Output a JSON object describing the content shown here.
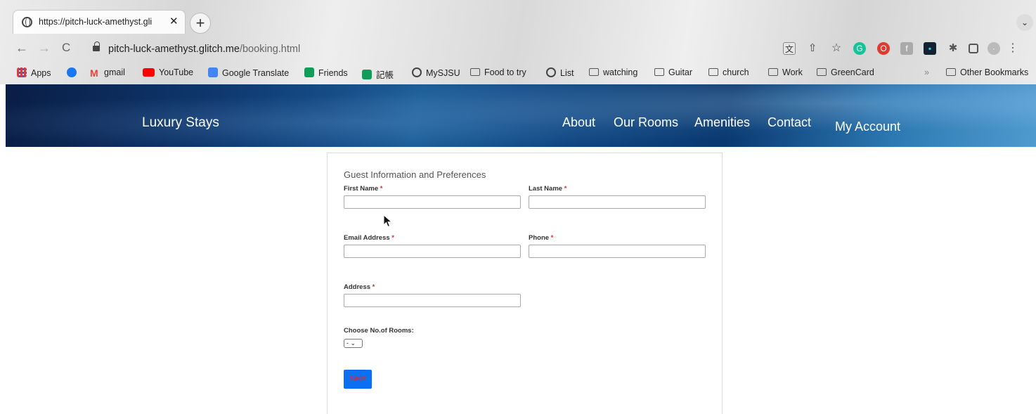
{
  "browser": {
    "tab_title": "https://pitch-luck-amethyst.gli",
    "tab_close": "✕",
    "new_tab": "+",
    "tab_menu": "⌄",
    "url_host": "pitch-luck-amethyst.glitch.me",
    "url_path": "/booking.html",
    "nav": {
      "back": "←",
      "forward": "→",
      "reload": "C"
    },
    "bookmarks": [
      {
        "label": "Apps",
        "icon": "apps-grid-icon"
      },
      {
        "label": "",
        "icon": "facebook-icon"
      },
      {
        "label": "gmail",
        "icon": "gmail-icon"
      },
      {
        "label": "YouTube",
        "icon": "youtube-icon"
      },
      {
        "label": "Google Translate",
        "icon": "translate-icon"
      },
      {
        "label": "Friends",
        "icon": "plus-green-icon"
      },
      {
        "label": "記帳",
        "icon": "plus-green-icon"
      },
      {
        "label": "MySJSU",
        "icon": "globe-icon"
      },
      {
        "label": "Food to try",
        "icon": "folder-icon"
      },
      {
        "label": "List",
        "icon": "globe-icon"
      },
      {
        "label": "watching",
        "icon": "folder-icon"
      },
      {
        "label": "Guitar",
        "icon": "folder-icon"
      },
      {
        "label": "church",
        "icon": "folder-icon"
      },
      {
        "label": "Work",
        "icon": "folder-icon"
      },
      {
        "label": "GreenCard",
        "icon": "folder-icon"
      }
    ],
    "more_bookmarks": "»",
    "other_bookmarks": "Other Bookmarks"
  },
  "site": {
    "brand": "Luxury Stays",
    "nav": [
      "About",
      "Our Rooms",
      "Amenities",
      "Contact",
      "My Account"
    ]
  },
  "form": {
    "title": "Guest Information and Preferences",
    "first_name_label": "First Name",
    "last_name_label": "Last Name",
    "email_label": "Email Address",
    "phone_label": "Phone",
    "address_label": "Address",
    "required_mark": "*",
    "rooms_label": "Choose No.of Rooms:",
    "rooms_selected": "-",
    "next_label": "Next",
    "first_name_value": "",
    "last_name_value": "",
    "email_value": "",
    "phone_value": "",
    "address_value": ""
  },
  "colors": {
    "required": "#d9302b",
    "next_bg": "#0a6ff0",
    "next_text": "#e22222",
    "header_dark": "#0a1d45"
  }
}
